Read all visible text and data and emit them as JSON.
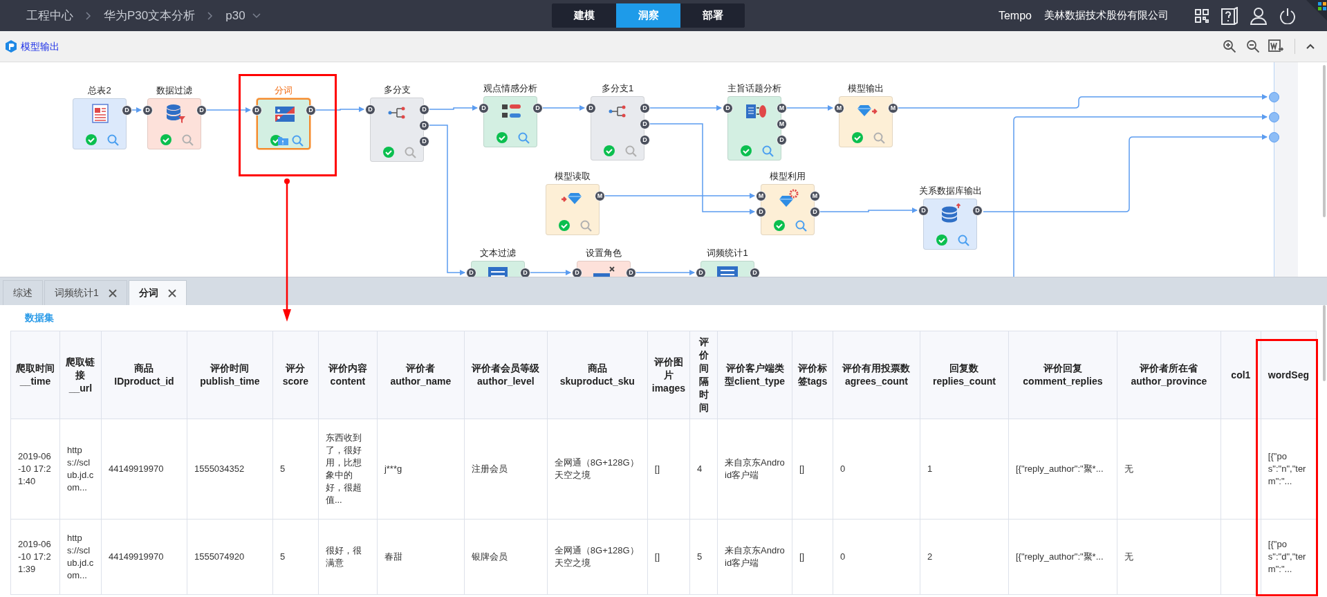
{
  "breadcrumbs": [
    {
      "label": "工程中心"
    },
    {
      "label": "华为P30文本分析"
    },
    {
      "label": "p30",
      "dropdown": true
    }
  ],
  "modes": [
    {
      "label": "建模",
      "selected": false
    },
    {
      "label": "洞察",
      "selected": true
    },
    {
      "label": "部署",
      "selected": false
    }
  ],
  "user": {
    "name": "Tempo",
    "company": "美林数据技术股份有限公司"
  },
  "toolbar": {
    "title": "模型输出"
  },
  "nodes": [
    {
      "label": "总表2",
      "kind": "table",
      "color": "#dce9fb",
      "selected": false,
      "outputs": [
        "D"
      ],
      "done": true,
      "preview": true
    },
    {
      "label": "数据过滤",
      "kind": "filter",
      "color": "#fde1da",
      "selected": false,
      "inputs": [
        "D"
      ],
      "outputs": [
        "D"
      ],
      "done": true,
      "preview": false
    },
    {
      "label": "分词",
      "kind": "segment",
      "color": "#d3efe2",
      "selected": true,
      "inputs": [
        "D"
      ],
      "outputs": [
        "D"
      ],
      "done": true,
      "preview": true,
      "saved": true
    },
    {
      "label": "多分支",
      "kind": "branch",
      "color": "#e8eaee",
      "selected": false,
      "inputs": [
        "D"
      ],
      "outputs": [
        "D",
        "D",
        "D"
      ],
      "done": true,
      "preview": false
    },
    {
      "label": "观点情感分析",
      "kind": "sentiment",
      "color": "#d3efe2",
      "selected": false,
      "inputs": [
        "D"
      ],
      "outputs": [
        "D"
      ],
      "done": true,
      "preview": true
    },
    {
      "label": "多分支1",
      "kind": "branch",
      "color": "#e8eaee",
      "selected": false,
      "inputs": [
        "D"
      ],
      "outputs": [
        "D",
        "D",
        "D"
      ],
      "done": true,
      "preview": false
    },
    {
      "label": "主旨话题分析",
      "kind": "topic",
      "color": "#d3efe2",
      "selected": false,
      "inputs": [
        "D"
      ],
      "outputs": [
        "M",
        "M",
        "D"
      ],
      "done": true,
      "preview": true
    },
    {
      "label": "模型输出",
      "kind": "model-output",
      "color": "#fdefd6",
      "selected": false,
      "inputs": [
        "M"
      ],
      "outputs": [
        "M"
      ],
      "done": true,
      "preview": false
    },
    {
      "label": "模型读取",
      "kind": "model-read",
      "color": "#fdefd6",
      "selected": false,
      "outputs": [
        "M"
      ],
      "done": true,
      "preview": false
    },
    {
      "label": "模型利用",
      "kind": "model-apply",
      "color": "#fdefd6",
      "selected": false,
      "inputs": [
        "M",
        "D"
      ],
      "outputs": [
        "M",
        "D"
      ],
      "done": true,
      "preview": true
    },
    {
      "label": "关系数据库输出",
      "kind": "db-output",
      "color": "#dce9fb",
      "selected": false,
      "inputs": [
        "D"
      ],
      "outputs": [
        "D"
      ],
      "done": true,
      "preview": true
    },
    {
      "label": "文本过滤",
      "kind": "text-filter",
      "color": "#d3efe2",
      "selected": false,
      "inputs": [
        "D"
      ],
      "outputs": [
        "D"
      ]
    },
    {
      "label": "设置角色",
      "kind": "role",
      "color": "#fde1da",
      "selected": false,
      "inputs": [
        "D"
      ],
      "outputs": [
        "D"
      ]
    },
    {
      "label": "词频统计1",
      "kind": "word-freq",
      "color": "#d3efe2",
      "selected": false,
      "inputs": [
        "D"
      ],
      "outputs": [
        "D"
      ]
    }
  ],
  "tabs": [
    {
      "label": "综述",
      "selected": false,
      "closable": false
    },
    {
      "label": "词频统计1",
      "selected": false,
      "closable": true
    },
    {
      "label": "分词",
      "selected": true,
      "closable": true
    }
  ],
  "section_title": "数据集",
  "table": {
    "columns": [
      {
        "label": "爬取时间__time",
        "kind": "text"
      },
      {
        "label": "爬取链接__url",
        "kind": "text"
      },
      {
        "label": "商品IDproduct_id",
        "kind": "text"
      },
      {
        "label": "评价时间publish_time",
        "kind": "text"
      },
      {
        "label": "评分score",
        "kind": "text"
      },
      {
        "label": "评价内容content",
        "kind": "text"
      },
      {
        "label": "评价者author_name",
        "kind": "text"
      },
      {
        "label": "评价者会员等级author_level",
        "kind": "text"
      },
      {
        "label": "商品skuproduct_sku",
        "kind": "text"
      },
      {
        "label": "评价图片images",
        "kind": "text"
      },
      {
        "label": "评价间隔时间",
        "kind": "text"
      },
      {
        "label": "评价客户端类型client_type",
        "kind": "text"
      },
      {
        "label": "评价标签tags",
        "kind": "text"
      },
      {
        "label": "评价有用投票数agrees_count",
        "kind": "text"
      },
      {
        "label": "回复数replies_count",
        "kind": "text"
      },
      {
        "label": "评价回复comment_replies",
        "kind": "text"
      },
      {
        "label": "评价者所在省author_province",
        "kind": "text"
      },
      {
        "label": "col1",
        "kind": "blank"
      },
      {
        "label": "wordSeg",
        "kind": "text"
      }
    ],
    "rows": [
      [
        "2019-06-10 17:21:40",
        "https://sclub.jd.com...",
        "44149919970",
        "1555034352",
        "5",
        "东西收到了，很好用，比想象中的好，很超值...",
        "j***g",
        "注册会员",
        "全网通（8G+128G）天空之境",
        "[]",
        "4",
        "来自京东Android客户端",
        "[]",
        "0",
        "1",
        "[{\"reply_author\":\"聚*...",
        "无",
        "[{\"pos\":\"n\",\"term\":\"..."
      ],
      [
        "2019-06-10 17:21:39",
        "https://sclub.jd.com...",
        "44149919970",
        "1555074920",
        "5",
        "很好，很满意",
        "春甜",
        "银牌会员",
        "全网通（8G+128G）天空之境",
        "[]",
        "5",
        "来自京东Android客户端",
        "[]",
        "0",
        "2",
        "[{\"reply_author\":\"聚*...",
        "无",
        "[{\"pos\":\"d\",\"term\":\"..."
      ]
    ]
  }
}
